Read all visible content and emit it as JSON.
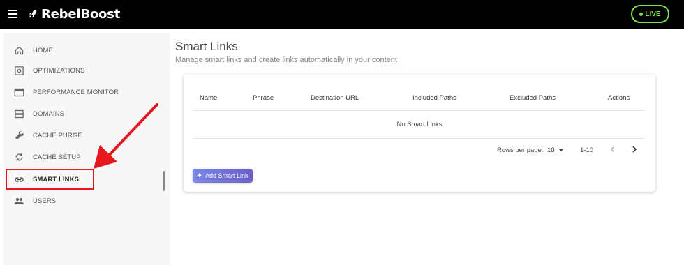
{
  "header": {
    "brand": "RebelBoost",
    "live_label": "LIVE"
  },
  "sidebar": {
    "items": [
      {
        "label": "HOME",
        "icon": "home-icon"
      },
      {
        "label": "OPTIMIZATIONS",
        "icon": "settings-box-icon"
      },
      {
        "label": "PERFORMANCE MONITOR",
        "icon": "browser-window-icon"
      },
      {
        "label": "DOMAINS",
        "icon": "server-icon"
      },
      {
        "label": "CACHE PURGE",
        "icon": "wrench-icon"
      },
      {
        "label": "CACHE SETUP",
        "icon": "cached-icon"
      },
      {
        "label": "SMART LINKS",
        "icon": "link-icon",
        "active": true
      },
      {
        "label": "USERS",
        "icon": "people-icon"
      }
    ]
  },
  "main": {
    "title": "Smart Links",
    "subtitle": "Manage smart links and create links automatically in your content",
    "table": {
      "columns": [
        "Name",
        "Phrase",
        "Destination URL",
        "Included Paths",
        "Excluded Paths",
        "Actions"
      ],
      "empty_text": "No Smart Links"
    },
    "pagination": {
      "rows_per_page_label": "Rows per page:",
      "rows_per_page_value": "10",
      "range": "1-10"
    },
    "add_button_label": "Add Smart Link"
  },
  "colors": {
    "accent_live": "#7be24a",
    "annotation_red": "#e8161d",
    "button_gradient_start": "#7b86e6",
    "button_gradient_end": "#6a5fc7"
  }
}
